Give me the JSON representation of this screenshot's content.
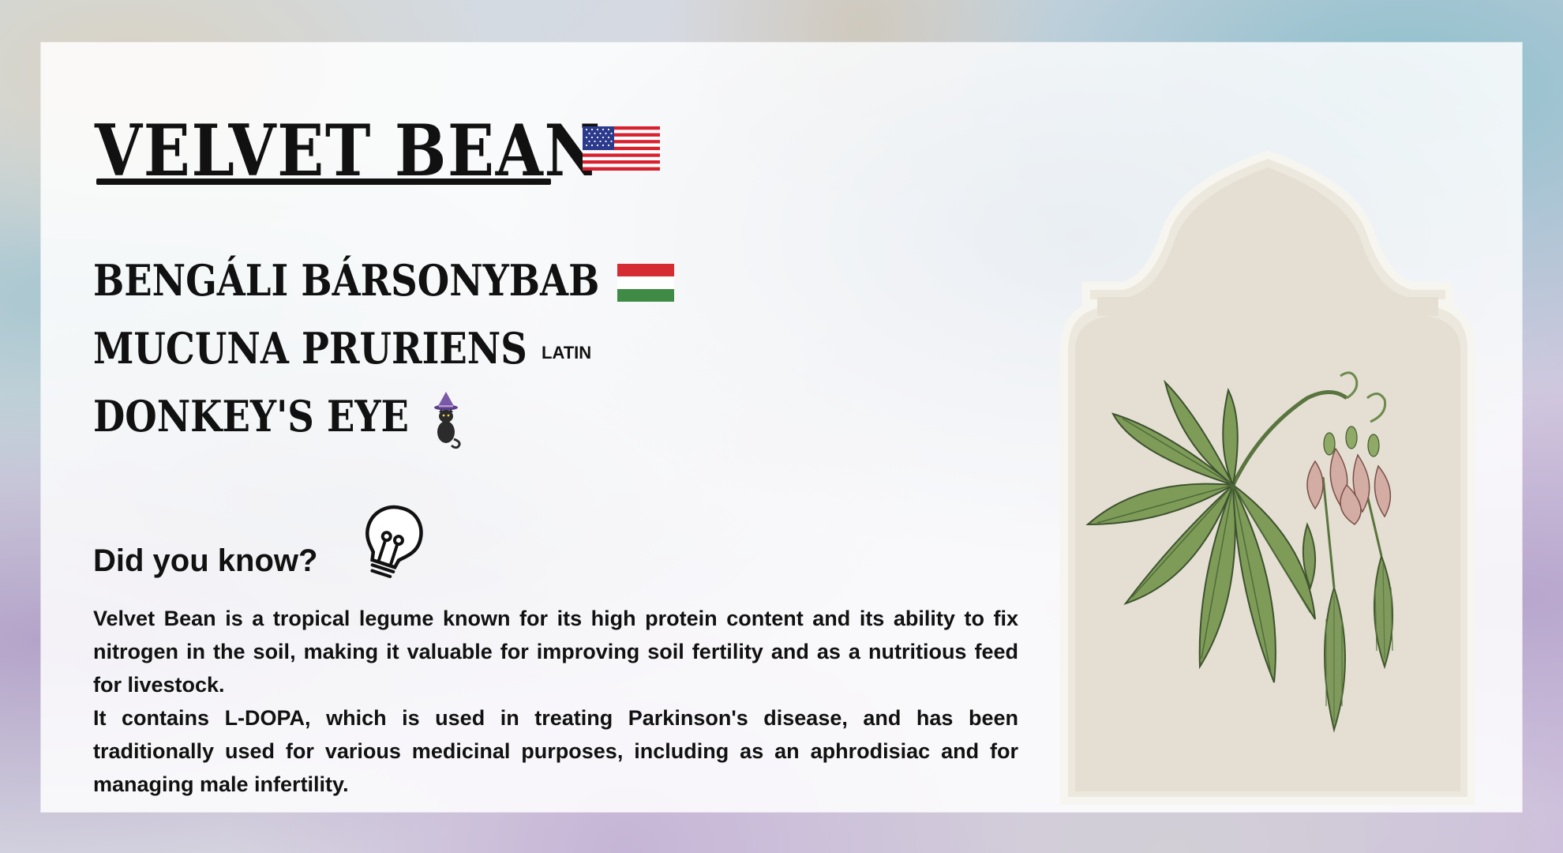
{
  "card": {
    "title": "VELVET BEAN",
    "names": [
      {
        "text": "BENGÁLI BÁRSONYBAB",
        "flag": "hungarian-flag"
      },
      {
        "text": "MUCUNA PRURIENS",
        "tag": "LATIN"
      },
      {
        "text": "DONKEY'S EYE",
        "icon": "witch-cat-icon"
      }
    ],
    "title_flag": "us-flag",
    "did_you_know": "Did you know?",
    "paragraphs": [
      "Velvet Bean is a tropical legume known for its high protein content and its ability to fix nitrogen in the soil, making it valuable for improving soil fertility and as a nutritious feed for livestock.",
      "It contains L-DOPA, which is used in treating Parkinson's disease, and has been traditionally used for various medicinal purposes, including as an aphrodisiac and for managing male infertility."
    ]
  },
  "colors": {
    "text": "#111111",
    "panel": "#ffffff",
    "arch_fill": "#e7e2d6",
    "leaf_green": "#6f8f4c",
    "flower_pink": "#c9a197"
  }
}
